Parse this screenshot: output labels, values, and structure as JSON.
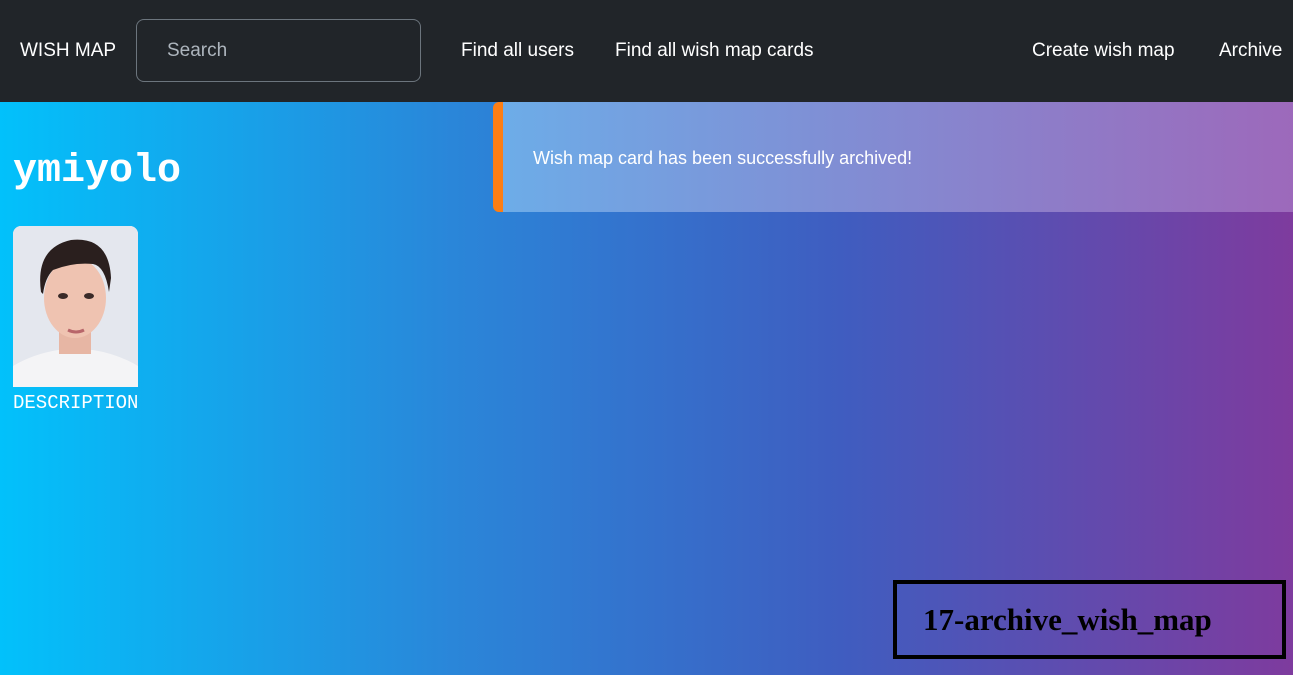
{
  "navbar": {
    "brand": "WISH MAP",
    "search_placeholder": "Search",
    "links": {
      "find_users": "Find all users",
      "find_cards": "Find all wish map cards",
      "create": "Create wish map",
      "archive": "Archive"
    }
  },
  "toast": {
    "message": "Wish map card has been successfully archived!",
    "accent_color": "#fd7e14"
  },
  "profile": {
    "username": "ymiyolo",
    "description": "DESCRIPTION"
  },
  "caption": {
    "label": "17-archive_wish_map"
  },
  "colors": {
    "navbar_bg": "#212529",
    "gradient_start": "#02c1fb",
    "gradient_end": "#7e3b9e"
  }
}
